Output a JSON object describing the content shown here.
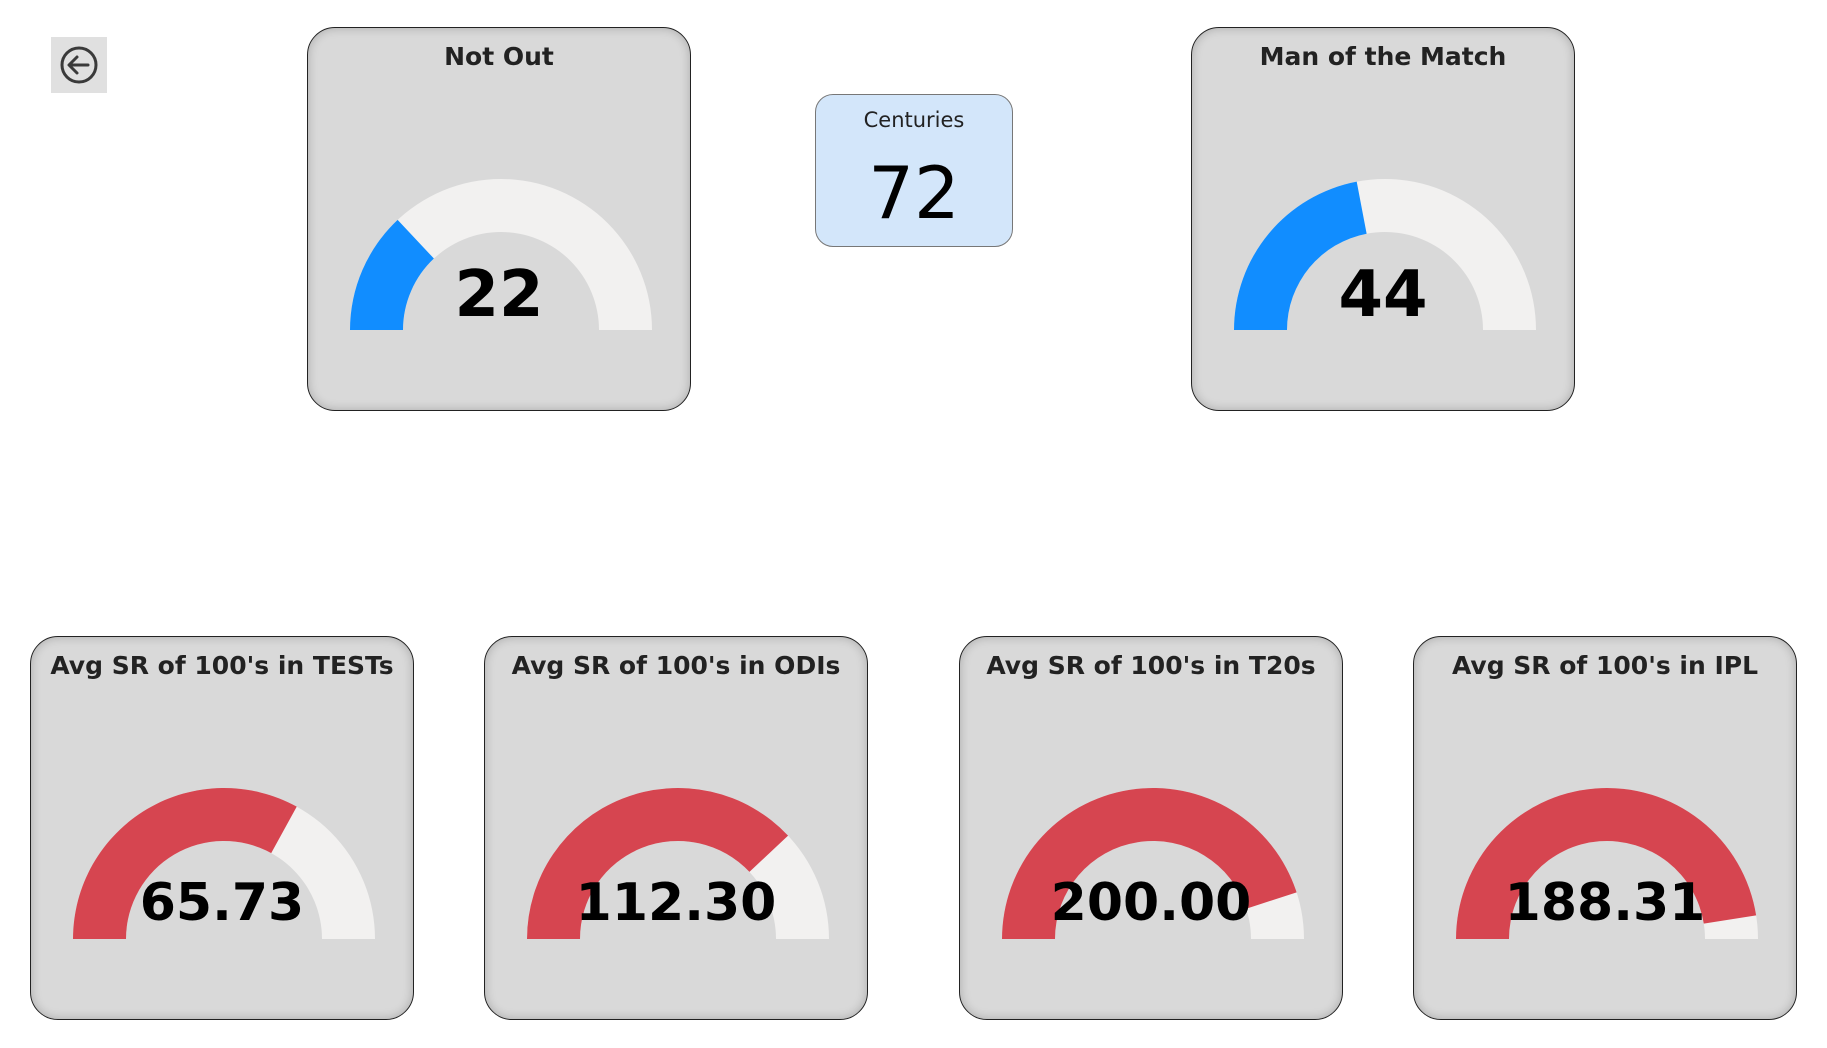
{
  "navigation": {
    "back_icon": "arrow-left-circle-icon"
  },
  "kpi": {
    "label": "Centuries",
    "value": "72"
  },
  "gauges": {
    "not_out": {
      "title": "Not Out",
      "value_label": "22",
      "value": 22,
      "fill_fraction": 0.26,
      "color": "#118DFF"
    },
    "motm": {
      "title": "Man of the Match",
      "value_label": "44",
      "value": 44,
      "fill_fraction": 0.44,
      "color": "#118DFF"
    },
    "sr_tests": {
      "title": "Avg SR of 100's in TESTs",
      "value_label": "65.73",
      "value": 65.73,
      "fill_fraction": 0.66,
      "color": "#D64550"
    },
    "sr_odis": {
      "title": "Avg SR of 100's in ODIs",
      "value_label": "112.30",
      "value": 112.3,
      "fill_fraction": 0.76,
      "color": "#D64550"
    },
    "sr_t20s": {
      "title": "Avg SR of 100's in T20s",
      "value_label": "200.00",
      "value": 200.0,
      "fill_fraction": 0.9,
      "color": "#D64550"
    },
    "sr_ipl": {
      "title": "Avg SR of 100's in IPL",
      "value_label": "188.31",
      "value": 188.31,
      "fill_fraction": 0.95,
      "color": "#D64550"
    }
  }
}
